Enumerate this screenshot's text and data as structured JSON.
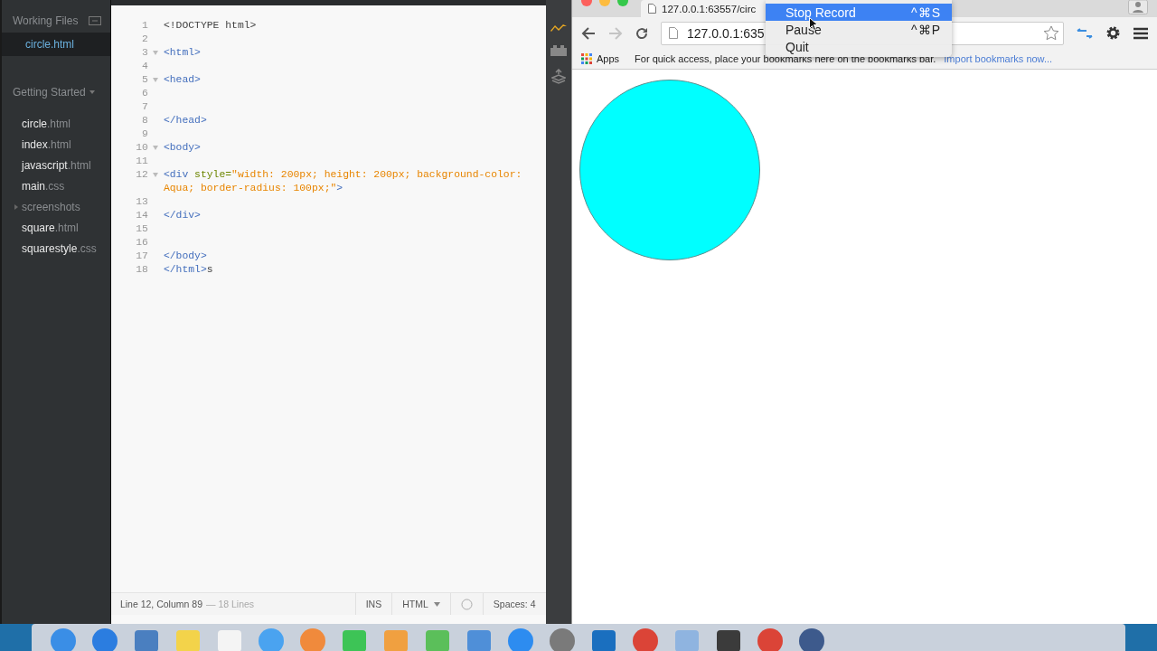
{
  "sidebar": {
    "working_files_title": "Working Files",
    "working_files": [
      {
        "name": "circle",
        "ext": ".html",
        "selected": true
      }
    ],
    "project_title": "Getting Started",
    "files": [
      {
        "kind": "file",
        "name": "circle",
        "ext": ".html"
      },
      {
        "kind": "file",
        "name": "index",
        "ext": ".html"
      },
      {
        "kind": "file",
        "name": "javascript",
        "ext": ".html"
      },
      {
        "kind": "file",
        "name": "main",
        "ext": ".css"
      },
      {
        "kind": "folder",
        "name": "screenshots"
      },
      {
        "kind": "file",
        "name": "square",
        "ext": ".html"
      },
      {
        "kind": "file",
        "name": "squarestyle",
        "ext": ".css"
      }
    ]
  },
  "editor": {
    "lines": [
      {
        "number": "1",
        "foldable": false,
        "tokens": [
          {
            "kind": "meta",
            "text": "<!DOCTYPE html>"
          }
        ]
      },
      {
        "number": "2",
        "foldable": false
      },
      {
        "number": "3",
        "foldable": true,
        "tokens": [
          {
            "kind": "tag",
            "text": "<html>"
          }
        ]
      },
      {
        "number": "4",
        "foldable": false
      },
      {
        "number": "5",
        "foldable": true,
        "tokens": [
          {
            "kind": "tag",
            "text": "<head>"
          }
        ]
      },
      {
        "number": "6",
        "foldable": false
      },
      {
        "number": "7",
        "foldable": false
      },
      {
        "number": "8",
        "foldable": false,
        "tokens": [
          {
            "kind": "tag",
            "text": "</head>"
          }
        ]
      },
      {
        "number": "9",
        "foldable": false
      },
      {
        "number": "10",
        "foldable": true,
        "tokens": [
          {
            "kind": "tag",
            "text": "<body>"
          }
        ]
      },
      {
        "number": "11",
        "foldable": false
      },
      {
        "number": "12",
        "foldable": true,
        "tokens": [
          {
            "kind": "tag",
            "text": "<div"
          },
          {
            "kind": "attr",
            "text": " style="
          },
          {
            "kind": "string",
            "text": "\"width: 200px; height: 200px; background-color: Aqua; border-radius: 100px;\""
          },
          {
            "kind": "tag",
            "text": ">"
          }
        ]
      },
      {
        "number": "13",
        "foldable": false
      },
      {
        "number": "14",
        "foldable": false,
        "tokens": [
          {
            "kind": "tag",
            "text": "</div>"
          }
        ]
      },
      {
        "number": "15",
        "foldable": false
      },
      {
        "number": "16",
        "foldable": false
      },
      {
        "number": "17",
        "foldable": false,
        "tokens": [
          {
            "kind": "tag",
            "text": "</body>"
          }
        ]
      },
      {
        "number": "18",
        "foldable": false,
        "tokens": [
          {
            "kind": "tag",
            "text": "</html>"
          },
          {
            "kind": "plain",
            "text": "s"
          }
        ]
      }
    ]
  },
  "status_bar": {
    "position": "Line 12, Column 89",
    "line_count": "— 18 Lines",
    "mode": "INS",
    "language": "HTML",
    "indent": "Spaces: 4"
  },
  "browser": {
    "tab_title": "127.0.0.1:63557/circ",
    "address": "127.0.0.1:635",
    "forward_disabled": true,
    "apps_label": "Apps",
    "bookmarks_hint": "For quick access, place your bookmarks here on the bookmarks bar.",
    "import_link": "Import bookmarks now..."
  },
  "context_menu": {
    "items": [
      {
        "label": "Stop Record",
        "shortcut": "^⌘S",
        "selected": true
      },
      {
        "label": "Pause",
        "shortcut": "^⌘P",
        "selected": false
      },
      {
        "label": "Quit",
        "selected": false
      }
    ]
  }
}
